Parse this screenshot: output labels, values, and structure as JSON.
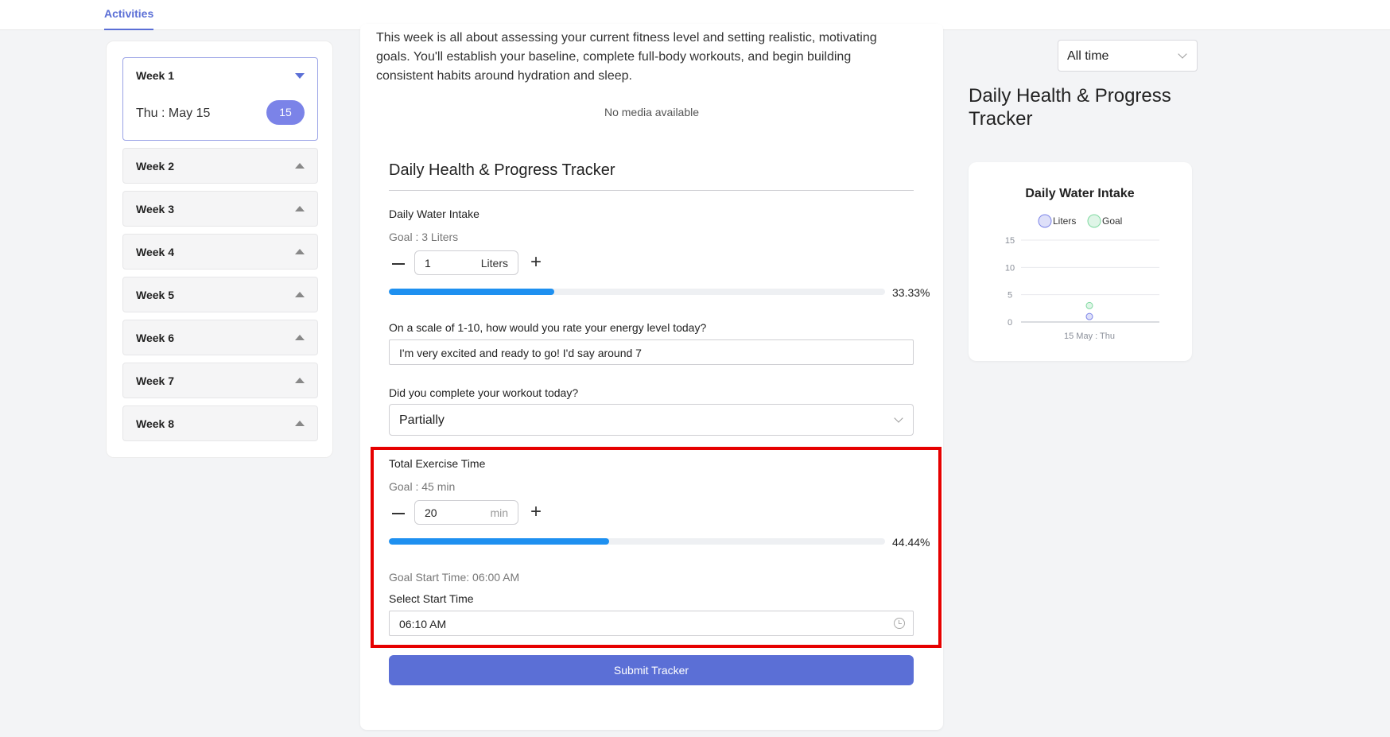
{
  "nav": {
    "tab_activities": "Activities"
  },
  "sidebar": {
    "weeks": [
      {
        "label": "Week 1",
        "expanded": true,
        "day": "Thu : May 15",
        "day_badge": "15"
      },
      {
        "label": "Week 2",
        "expanded": false
      },
      {
        "label": "Week 3",
        "expanded": false
      },
      {
        "label": "Week 4",
        "expanded": false
      },
      {
        "label": "Week 5",
        "expanded": false
      },
      {
        "label": "Week 6",
        "expanded": false
      },
      {
        "label": "Week 7",
        "expanded": false
      },
      {
        "label": "Week 8",
        "expanded": false
      }
    ]
  },
  "main": {
    "description": "This week is all about assessing your current fitness level and setting realistic, motivating goals. You'll establish your baseline, complete full-body workouts, and begin building consistent habits around hydration and sleep.",
    "no_media": "No media available",
    "tracker_title": "Daily Health & Progress Tracker",
    "water": {
      "label": "Daily Water Intake",
      "goal": "Goal : 3 Liters",
      "value": "1",
      "unit": "Liters",
      "progress": 0.3333,
      "progress_text": "33.33%"
    },
    "energy": {
      "label": "On a scale of 1-10, how would you rate your energy level today?",
      "value": "I'm very excited and ready to go! I'd say around 7"
    },
    "workout": {
      "label": "Did you complete your workout today?",
      "value": "Partially"
    },
    "exercise": {
      "label": "Total Exercise Time",
      "goal": "Goal : 45 min",
      "value": "20",
      "unit": "min",
      "progress": 0.4444,
      "progress_text": "44.44%",
      "goal_start": "Goal Start Time: 06:00 AM",
      "start_label": "Select Start Time",
      "start_value": "06:10 AM"
    },
    "submit_label": "Submit Tracker"
  },
  "right": {
    "range_value": "All time",
    "title": "Daily Health & Progress Tracker"
  },
  "chart_data": {
    "type": "scatter",
    "title": "Daily Water Intake",
    "legend": [
      "Liters",
      "Goal"
    ],
    "legend_position": "top",
    "x": [
      "15 May : Thu"
    ],
    "series": [
      {
        "name": "Liters",
        "values": [
          1
        ],
        "color": "#7b83e8"
      },
      {
        "name": "Goal",
        "values": [
          3
        ],
        "color": "#7fd9a0"
      }
    ],
    "yticks": [
      0,
      5,
      10,
      15
    ],
    "ylim": [
      0,
      15
    ],
    "grid": true
  },
  "colors": {
    "accent": "#5b6fd6",
    "progress": "#1e90f0",
    "highlight": "#e60000"
  }
}
